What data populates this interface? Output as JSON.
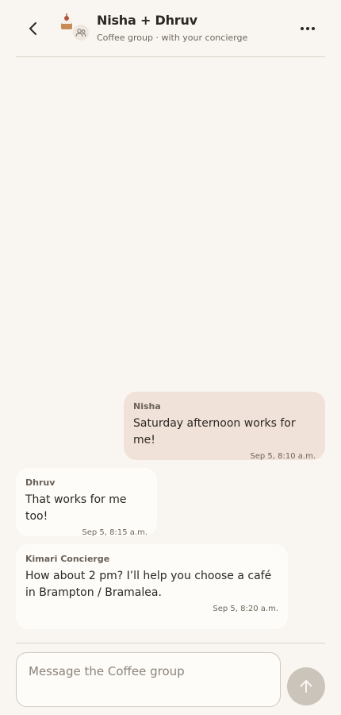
{
  "header": {
    "title": "Nisha + Dhruv",
    "subtitle": "Coffee group · with your concierge",
    "back_icon": "chevron-left-icon",
    "more_icon": "more-horizontal-icon",
    "avatar_icon": "cake-icon",
    "group_icon": "group-icon"
  },
  "messages": [
    {
      "sender": "Nisha",
      "text": "Saturday afternoon works for me!",
      "time": "Sep 5, 8:10 a.m."
    },
    {
      "sender": "Dhruv",
      "text": "That works for me too!",
      "time": "Sep 5, 8:15 a.m."
    },
    {
      "sender": "Kimari Concierge",
      "text": "How about 2 pm? I’ll help you choose a café in Brampton / Bramalea.",
      "time": "Sep 5, 8:20 a.m."
    }
  ],
  "composer": {
    "placeholder": "Message the Coffee group",
    "value": "",
    "send_icon": "arrow-up-icon"
  },
  "colors": {
    "background": "#f9f6f1",
    "own_bubble": "#f1e2d9",
    "other_bubble": "#fefcf8",
    "send_button": "#cbc4bb"
  }
}
